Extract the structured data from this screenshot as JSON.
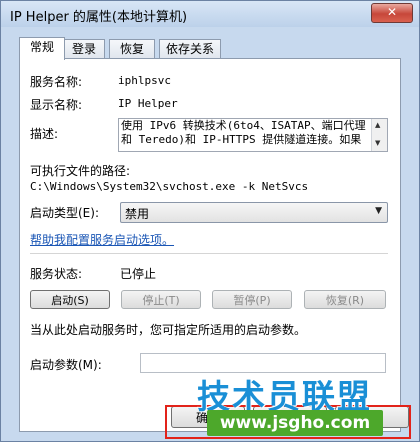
{
  "window": {
    "title": "IP Helper 的属性(本地计算机)",
    "close_glyph": "✕"
  },
  "tabs": [
    "常规",
    "登录",
    "恢复",
    "依存关系"
  ],
  "general": {
    "service_name_label": "服务名称:",
    "service_name_value": "iphlpsvc",
    "display_name_label": "显示名称:",
    "display_name_value": "IP Helper",
    "description_label": "描述:",
    "description_text": "使用 IPv6 转换技术(6to4、ISATAP、端口代理和 Teredo)和 IP-HTTPS 提供隧道连接。如果",
    "exe_path_label": "可执行文件的路径:",
    "exe_path_value": "C:\\Windows\\System32\\svchost.exe -k NetSvcs",
    "startup_type_label": "启动类型(E):",
    "startup_type_value": "禁用",
    "help_link": "帮助我配置服务启动选项。",
    "status_label": "服务状态:",
    "status_value": "已停止",
    "buttons": {
      "start": "启动(S)",
      "stop": "停止(T)",
      "pause": "暂停(P)",
      "resume": "恢复(R)"
    },
    "hint_text": "当从此处启动服务时，您可指定所适用的启动参数。",
    "start_params_label": "启动参数(M):",
    "start_params_value": ""
  },
  "footer": {
    "ok_label": "确定"
  },
  "watermark": {
    "brand": "技术员联盟",
    "url": "www.jsgho.com"
  },
  "colors": {
    "link": "#1a56b5",
    "highlight_box": "#e2231a",
    "watermark_blue": "#1a8fd6",
    "watermark_green": "#4da82b"
  }
}
